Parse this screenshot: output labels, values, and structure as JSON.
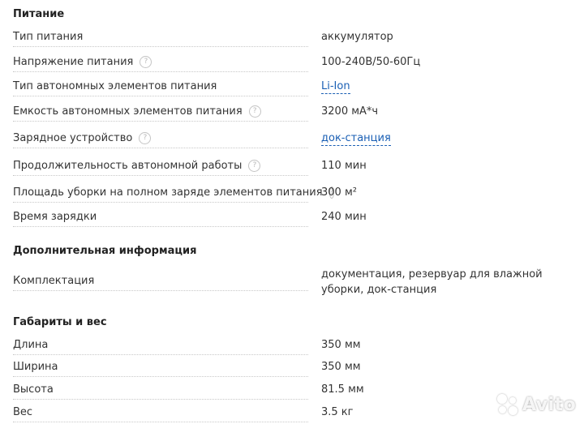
{
  "sections": {
    "power": {
      "title": "Питание",
      "rows": [
        {
          "label": "Тип питания",
          "value": "аккумулятор"
        },
        {
          "label": "Напряжение питания",
          "value": "100-240В/50-60Гц"
        },
        {
          "label": "Тип автономных элементов питания",
          "value": "Li-Ion"
        },
        {
          "label": "Емкость автономных элементов питания",
          "value": "3200 мА*ч"
        },
        {
          "label": "Зарядное устройство",
          "value": "док-станция"
        },
        {
          "label": "Продолжительность автономной работы",
          "value": "110 мин"
        },
        {
          "label": "Площадь уборки на полном заряде элементов питания",
          "value": "300 м²"
        },
        {
          "label": "Время зарядки",
          "value": "240 мин"
        }
      ]
    },
    "extra": {
      "title": "Дополнительная информация",
      "rows": [
        {
          "label": "Комплектация",
          "value": "документация, резервуар для влажной уборки, док-станция"
        }
      ]
    },
    "dimensions": {
      "title": "Габариты и вес",
      "rows": [
        {
          "label": "Длина",
          "value": "350 мм"
        },
        {
          "label": "Ширина",
          "value": "350 мм"
        },
        {
          "label": "Высота",
          "value": "81.5 мм"
        },
        {
          "label": "Вес",
          "value": "3.5 кг"
        }
      ]
    }
  },
  "help_icon_glyph": "?",
  "watermark": {
    "text": "Avito",
    "icon": "avito-dots-icon"
  },
  "colors": {
    "link": "#1a5fb4",
    "text": "#333333",
    "help_icon": "#c4c4c4"
  }
}
